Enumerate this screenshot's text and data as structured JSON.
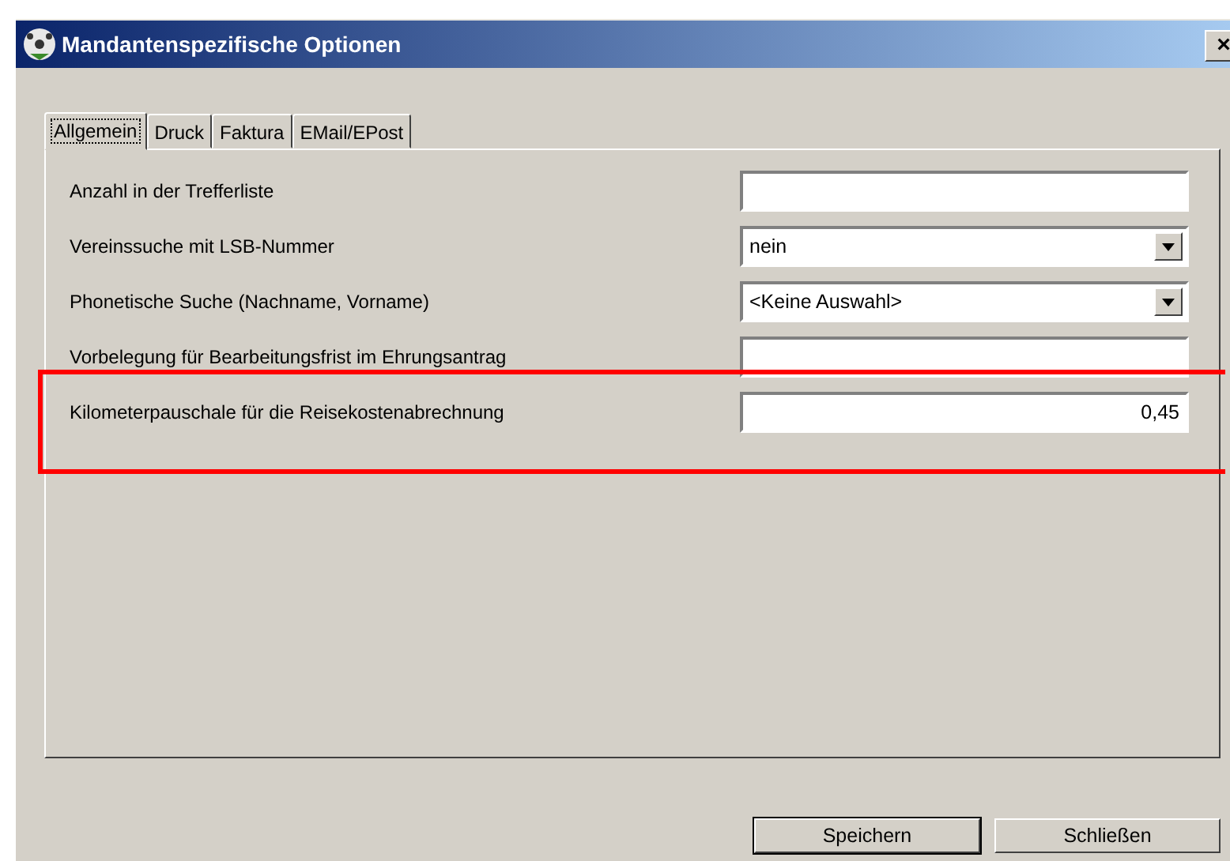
{
  "window": {
    "title": "Mandantenspezifische Optionen",
    "close": "×"
  },
  "tabs": [
    {
      "label": "Allgemein",
      "selected": true
    },
    {
      "label": "Druck",
      "selected": false
    },
    {
      "label": "Faktura",
      "selected": false
    },
    {
      "label": "EMail/EPost",
      "selected": false
    }
  ],
  "fields": [
    {
      "kind": "text",
      "label": "Anzahl in der Trefferliste",
      "highlighted": false
    },
    {
      "kind": "combo",
      "label": "Vereinssuche mit LSB-Nummer",
      "value": "nein",
      "highlighted": false
    },
    {
      "kind": "combo",
      "label": "Phonetische Suche (Nachname, Vorname)",
      "value": "<Keine Auswahl>",
      "highlighted": false
    },
    {
      "kind": "text",
      "label": "Vorbelegung für Bearbeitungsfrist im Ehrungsantrag",
      "highlighted": false
    },
    {
      "kind": "number",
      "label": "Kilometerpauschale für die Reisekostenabrechnung",
      "value": "0,45",
      "highlighted": true
    }
  ],
  "buttons": [
    {
      "label": "Speichern",
      "default": true
    },
    {
      "label": "Schließen",
      "default": false
    }
  ]
}
